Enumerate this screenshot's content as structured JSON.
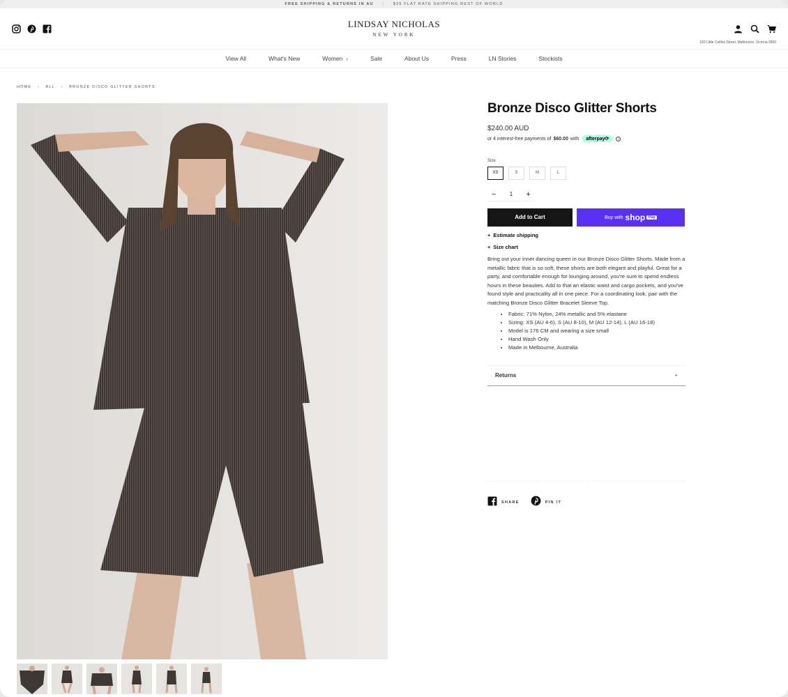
{
  "announcement": {
    "left": "FREE SHIPPING & RETURNS IN AU",
    "separator": "|",
    "right": "$35 FLAT RATE SHIPPING REST OF WORLD"
  },
  "header": {
    "logo_line1": "LINDSAY NICHOLAS",
    "logo_line2": "NEW YORK",
    "address": "183 Little Collins Street, Melbourne, Victoria 3000",
    "social_icons": [
      "instagram-icon",
      "pinterest-icon",
      "facebook-icon"
    ],
    "action_icons": [
      "account-icon",
      "search-icon",
      "cart-icon"
    ]
  },
  "nav": {
    "items": [
      {
        "label": "View All"
      },
      {
        "label": "What's New"
      },
      {
        "label": "Women",
        "chevron": "›"
      },
      {
        "label": "Sale"
      },
      {
        "label": "About Us"
      },
      {
        "label": "Press"
      },
      {
        "label": "LN Stories"
      },
      {
        "label": "Stockists"
      }
    ]
  },
  "breadcrumb": {
    "items": [
      "HOME",
      "ALL",
      "BRONZE DISCO GLITTER SHORTS"
    ],
    "separator": "›"
  },
  "product": {
    "title": "Bronze Disco Glitter Shorts",
    "price": "$240.00 AUD",
    "afterpay_prefix": "or 4 interest-free payments of",
    "afterpay_amount": "$60.00",
    "afterpay_with": "with",
    "afterpay_badge": "afterpay⟳",
    "info_glyph": "i",
    "size_label": "Size",
    "sizes": [
      "XS",
      "S",
      "M",
      "L"
    ],
    "selected_size": "XS",
    "qty_minus": "−",
    "quantity": "1",
    "qty_plus": "+",
    "add_to_cart": "Add to Cart",
    "buy_with": "Buy with",
    "shop_word": "shop",
    "pay_word": "Pay",
    "plus_glyph": "+",
    "estimate_shipping": "Estimate shipping",
    "size_chart": "Size chart",
    "description": "Bring out your inner dancing queen in our Bronze Disco Glitter Shorts. Made from a metallic fabric that is so soft, these shorts are both elegant and playful. Great for a party, and comfortable enough for lounging around, you're sure to spend endless hours in these beauties. Add to that an elastic waist and cargo pockets, and you've found style and practicality all in one piece. For a coordinating look, pair with the matching Bronze Disco Glitter Bracelet Sleeve Top.",
    "bullets": [
      "Fabric: 71% Nylon, 24% metallic and 5% elastane",
      "Sizing: XS (AU 4-6), S (AU 8-10), M (AU 12-14), L (AU 16-18)",
      "Model is 176 CM and wearing a size small",
      "Hand Wash Only",
      "Made in Melbourne, Australia"
    ],
    "returns_label": "Returns",
    "returns_plus": "+"
  },
  "share": {
    "facebook_label": "SHARE",
    "pinterest_label": "PIN IT"
  },
  "gallery": {
    "thumbnail_count": 6,
    "garment_color": "#3f3733"
  }
}
